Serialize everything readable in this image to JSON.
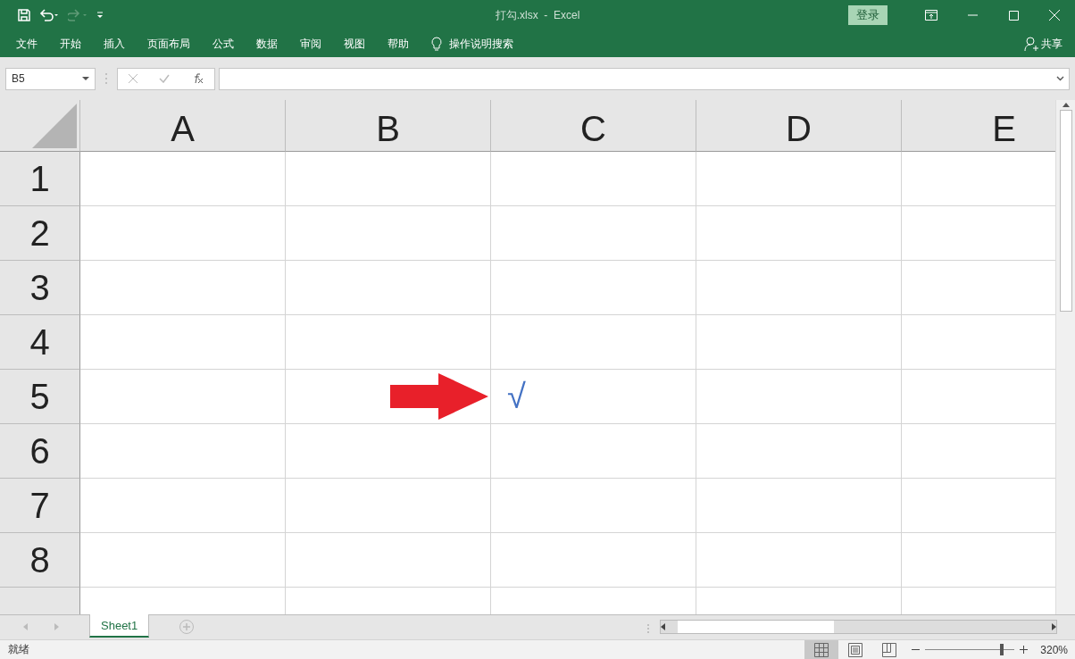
{
  "title_bar": {
    "title": "打勾.xlsx  -  Excel",
    "sign_in": "登录"
  },
  "ribbon": {
    "tabs": [
      "文件",
      "开始",
      "插入",
      "页面布局",
      "公式",
      "数据",
      "审阅",
      "视图",
      "帮助"
    ],
    "tell_me": "操作说明搜索",
    "share": "共享"
  },
  "formula_bar": {
    "name_box": "B5"
  },
  "sheet": {
    "columns": [
      "A",
      "B",
      "C",
      "D",
      "E"
    ],
    "rows": [
      {
        "label": "1",
        "cells": [
          null,
          null,
          null,
          null,
          null
        ]
      },
      {
        "label": "2",
        "cells": [
          null,
          null,
          null,
          null,
          null
        ]
      },
      {
        "label": "3",
        "cells": [
          null,
          null,
          null,
          null,
          null
        ]
      },
      {
        "label": "4",
        "cells": [
          null,
          null,
          null,
          null,
          null
        ]
      },
      {
        "label": "5",
        "cells": [
          null,
          null,
          "√",
          null,
          null
        ]
      },
      {
        "label": "6",
        "cells": [
          null,
          null,
          null,
          null,
          null
        ]
      },
      {
        "label": "7",
        "cells": [
          null,
          null,
          null,
          null,
          null
        ]
      },
      {
        "label": "8",
        "cells": [
          null,
          null,
          null,
          null,
          null
        ]
      },
      {
        "cells": [
          null,
          null,
          null,
          null,
          null
        ]
      }
    ],
    "annotations": [
      {
        "kind": "arrow"
      }
    ]
  },
  "sheet_tabs": [
    {
      "label": "Sheet1",
      "selected": true
    }
  ],
  "status_bar": {
    "status": "就绪",
    "views": [
      {
        "kind": "normal",
        "selected": true
      },
      {
        "kind": "page_layout",
        "selected": false
      },
      {
        "kind": "page_break",
        "selected": false
      }
    ],
    "zoom": {
      "level": 0.86,
      "reading": "320%"
    }
  }
}
